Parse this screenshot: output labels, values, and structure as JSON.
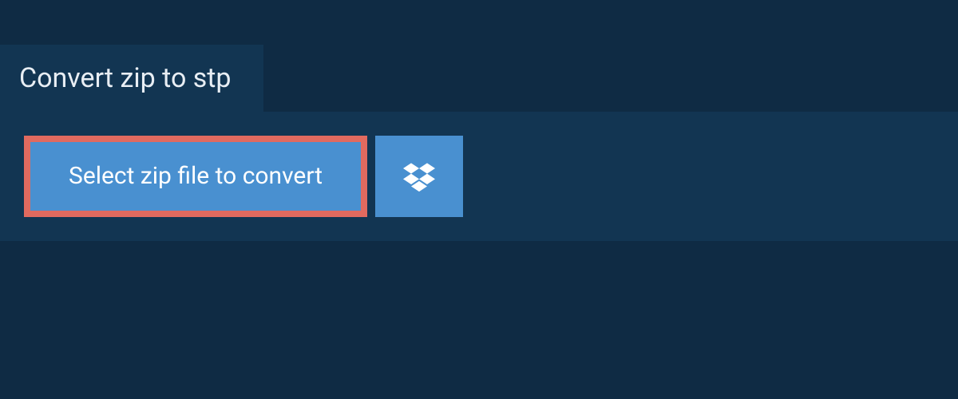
{
  "header": {
    "title": "Convert zip to stp"
  },
  "actions": {
    "select_file_label": "Select zip file to convert",
    "dropbox_icon": "dropbox-icon"
  },
  "colors": {
    "page_bg": "#0f2b44",
    "panel_bg": "#123552",
    "button_bg": "#4990d0",
    "highlight_border": "#e16a5f",
    "text_light": "#ffffff"
  }
}
